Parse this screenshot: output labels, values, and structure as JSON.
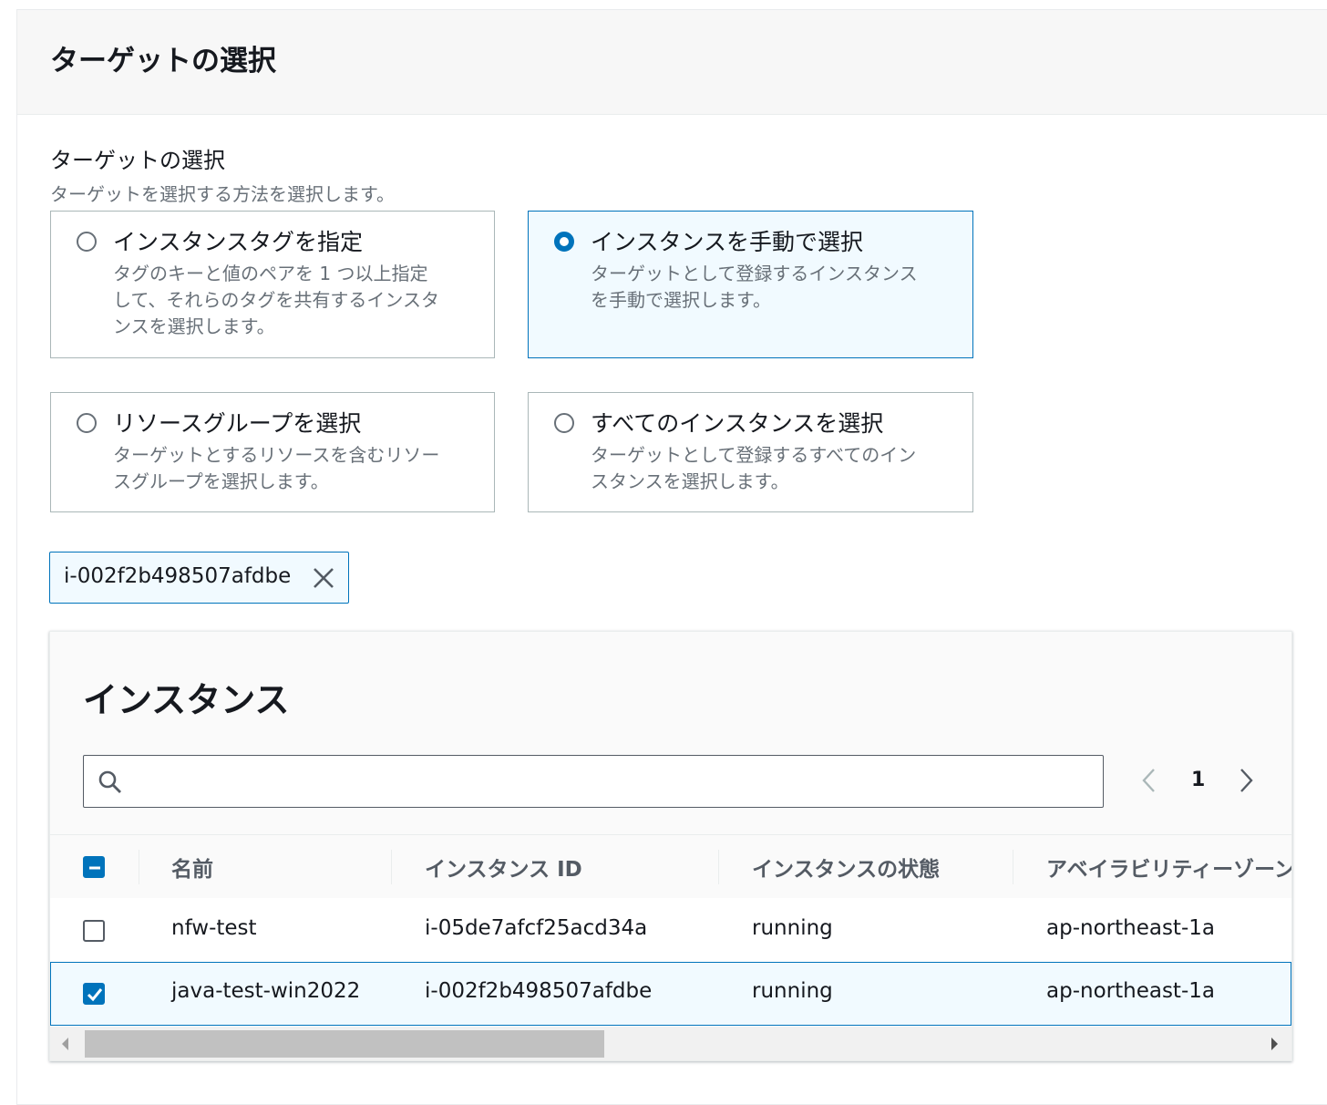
{
  "panel": {
    "title": "ターゲットの選択"
  },
  "target_field": {
    "label": "ターゲットの選択",
    "description": "ターゲットを選択する方法を選択します。",
    "options": [
      {
        "label": "インスタンスタグを指定",
        "description_lines": [
          "タグのキーと値のペアを 1 つ以上指定",
          "して、それらのタグを共有するインスタ",
          "ンスを選択します。"
        ],
        "selected": false
      },
      {
        "label": "インスタンスを手動で選択",
        "description_lines": [
          "ターゲットとして登録するインスタンス",
          "を手動で選択します。"
        ],
        "selected": true
      },
      {
        "label": "リソースグループを選択",
        "description_lines": [
          "ターゲットとするリソースを含むリソー",
          "スグループを選択します。"
        ],
        "selected": false
      },
      {
        "label": "すべてのインスタンスを選択",
        "description_lines": [
          "ターゲットとして登録するすべてのイン",
          "スタンスを選択します。"
        ],
        "selected": false
      }
    ]
  },
  "selected_token": {
    "text": "i-002f2b498507afdbe",
    "dismiss_icon": "close-icon"
  },
  "instances_table": {
    "title": "インスタンス",
    "search": {
      "value": "",
      "placeholder": "",
      "icon": "search-icon"
    },
    "pagination": {
      "current_page": "1",
      "prev_icon": "chevron-left-icon",
      "next_icon": "chevron-right-icon"
    },
    "columns": [
      "名前",
      "インスタンス ID",
      "インスタンスの状態",
      "アベイラビリティーゾーン"
    ],
    "header_checkbox_state": "indeterminate",
    "rows": [
      {
        "checked": false,
        "name": "nfw-test",
        "instance_id": "i-05de7afcf25acd34a",
        "state": "running",
        "az": "ap-northeast-1a"
      },
      {
        "checked": true,
        "name": "java-test-win2022",
        "instance_id": "i-002f2b498507afdbe",
        "state": "running",
        "az": "ap-northeast-1a"
      }
    ]
  },
  "colors": {
    "accent": "#0073bb",
    "selected_bg": "#f1faff",
    "border": "#aab7b8",
    "muted_text": "#687078",
    "header_text": "#545b64"
  }
}
